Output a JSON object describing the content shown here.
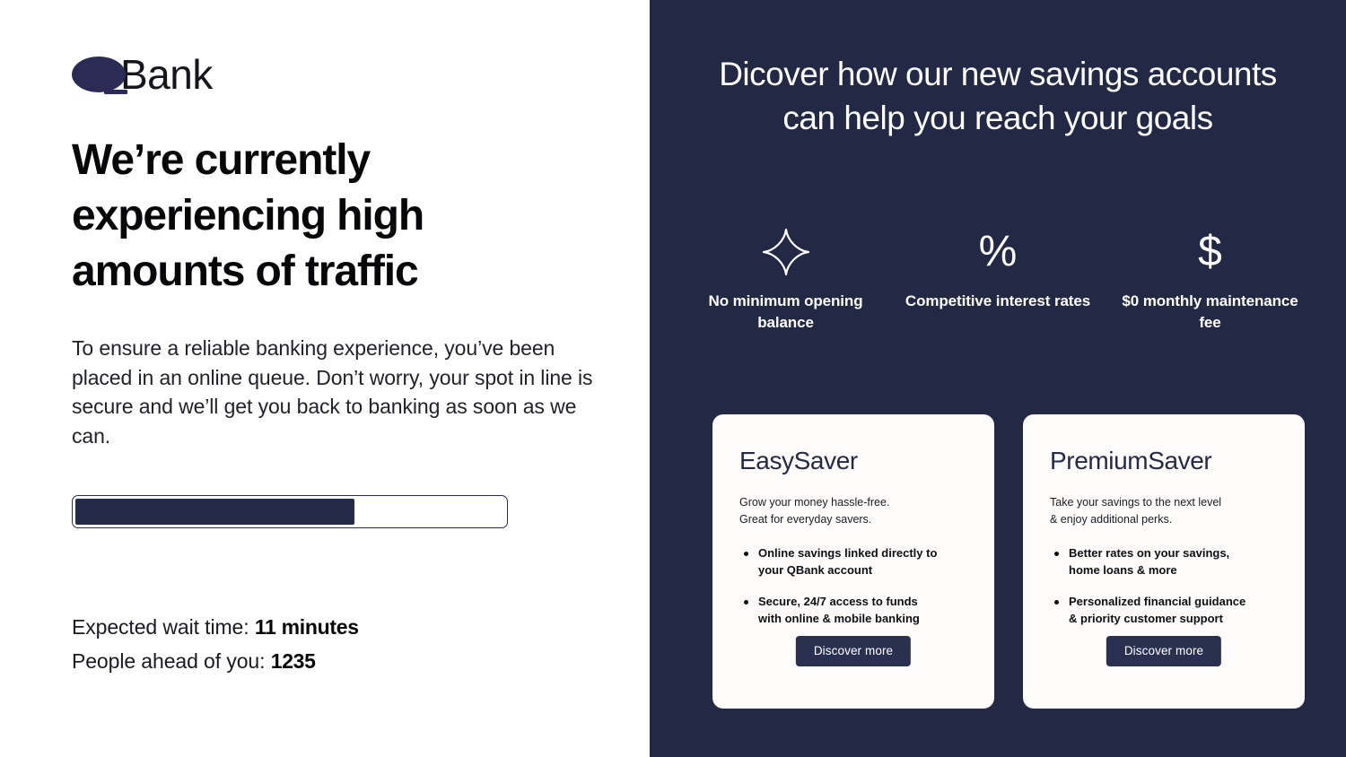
{
  "brand": {
    "logo_icon": "q-ellipse-logo",
    "name": "Bank",
    "navy": "#232844",
    "accent": "#2b2b55"
  },
  "left": {
    "headline": "We’re currently experiencing high amounts of traffic",
    "body": "To ensure a reliable banking experience, you’ve been placed in an online queue. Don’t worry, your spot in line is secure and we’ll get you back to banking as soon as we can.",
    "progress": {
      "percent": 65,
      "fill_color": "#262a49",
      "border_color": "#2b2b55"
    },
    "stats": [
      {
        "label": "Expected wait time:",
        "value": "11 minutes"
      },
      {
        "label": "People ahead of you:",
        "value": "1235"
      }
    ]
  },
  "right": {
    "heading": "Dicover how our new savings accounts can help you reach your goals",
    "features": [
      {
        "icon": "sparkle-star-icon",
        "glyph": "",
        "label": "No minimum\nopening balance"
      },
      {
        "icon": "percent-icon",
        "glyph": "%",
        "label": "Competitive\ninterest rates"
      },
      {
        "icon": "dollar-sign-icon",
        "glyph": "$",
        "label": "$0 monthly\nmaintenance fee"
      }
    ],
    "cards": [
      {
        "title": "EasySaver",
        "subtitle": "Grow your money hassle-free.\nGreat for everyday savers.",
        "bullets": [
          "Online savings linked directly to\nyour QBank account",
          "Secure, 24/7 access to funds\nwith online & mobile banking"
        ],
        "button": "Discover more"
      },
      {
        "title": "PremiumSaver",
        "subtitle": "Take your savings to the next level\n& enjoy additional perks.",
        "bullets": [
          "Better rates on your savings,\nhome loans  & more",
          "Personalized financial guidance\n& priority customer support"
        ],
        "button": "Discover more"
      }
    ]
  }
}
